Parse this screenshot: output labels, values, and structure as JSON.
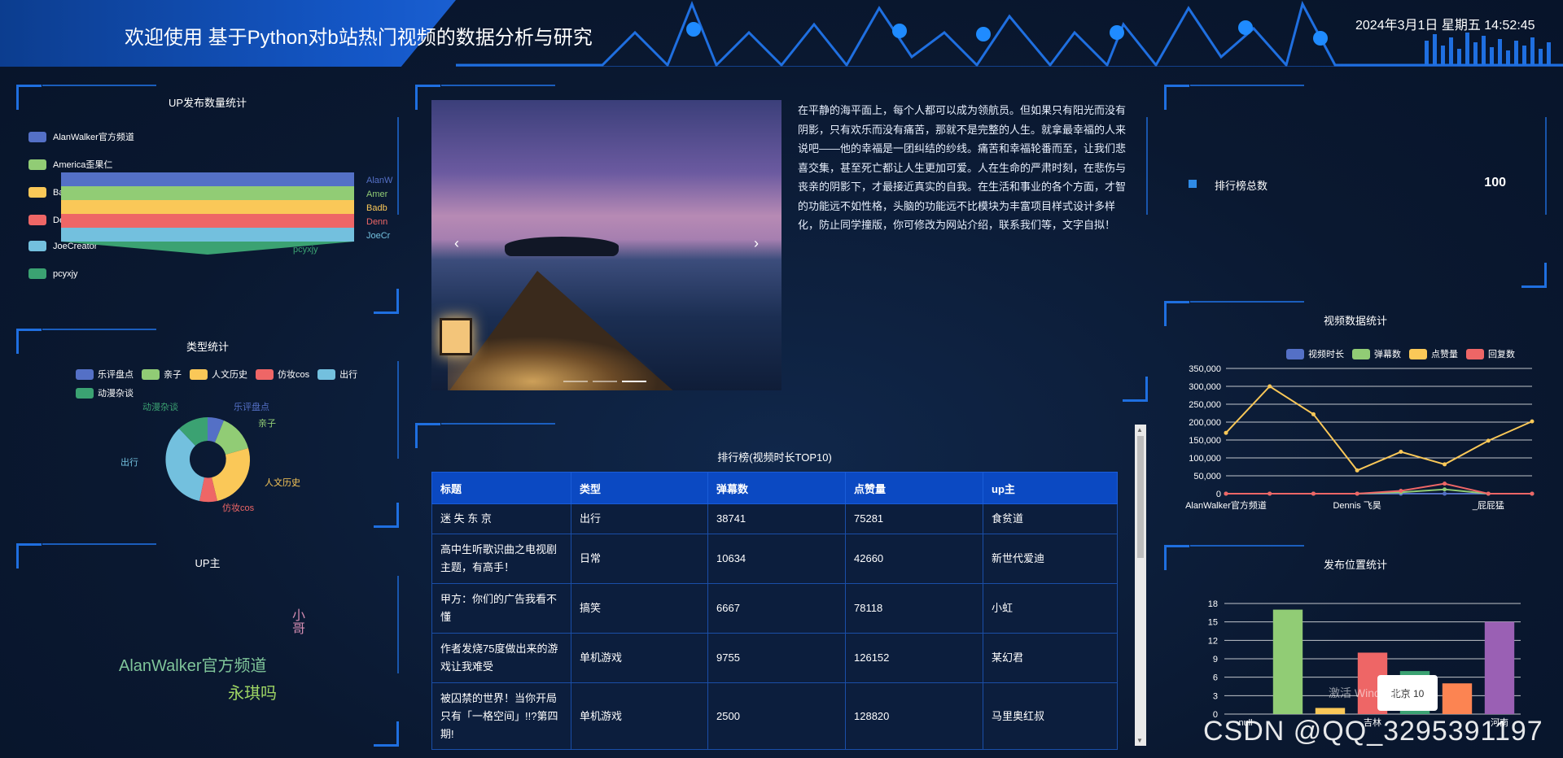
{
  "header": {
    "title": "欢迎使用 基于Python对b站热门视频的数据分析与研究",
    "datetime": "2024年3月1日 星期五 14:52:45"
  },
  "up_count": {
    "title": "UP发布数量统计",
    "legend": [
      "AlanWalker官方频道",
      "America歪果仁",
      "Badboy糖主",
      "Dennis 飞昊",
      "JoeCreator",
      "pcyxjy"
    ],
    "funnel_labels": [
      "AlanW",
      "Amer",
      "Badb",
      "Denn",
      "JoeCr"
    ],
    "funnel_bottom_label": "pcyxjy"
  },
  "type_stats": {
    "title": "类型统计",
    "legend": [
      "乐评盘点",
      "亲子",
      "人文历史",
      "仿妆cos",
      "出行",
      "动漫杂谈"
    ],
    "labels": [
      "动漫杂谈",
      "乐评盘点",
      "亲子",
      "人文历史",
      "仿妆cos",
      "出行"
    ]
  },
  "up_cloud": {
    "title": "UP主",
    "words": [
      {
        "text": "AlanWalker官方频道",
        "color": "#7fc59a",
        "size": 20
      },
      {
        "text": "永琪吗",
        "color": "#9fd664",
        "size": 20
      },
      {
        "text": "小哥",
        "color": "#d18bb0",
        "size": 16
      }
    ]
  },
  "intro": {
    "text": "在平静的海平面上，每个人都可以成为领航员。但如果只有阳光而没有阴影，只有欢乐而没有痛苦，那就不是完整的人生。就拿最幸福的人来说吧——他的幸福是一团纠结的纱线。痛苦和幸福轮番而至，让我们悲喜交集，甚至死亡都让人生更加可爱。人在生命的严肃时刻，在悲伤与丧亲的阴影下，才最接近真实的自我。在生活和事业的各个方面，才智的功能远不如性格，头脑的功能远不比模块为丰富项目样式设计多样化，防止同学撞版，你可修改为网站介绍，联系我们等，文字自拟！"
  },
  "carousel": {
    "prev": "‹",
    "next": "›"
  },
  "ranking": {
    "title": "排行榜(视频时长TOP10)",
    "columns": [
      "标题",
      "类型",
      "弹幕数",
      "点赞量",
      "up主"
    ],
    "rows": [
      [
        "迷 失 东 京",
        "出行",
        "38741",
        "75281",
        "食贫道"
      ],
      [
        "高中生听歌识曲之电视剧主题，有高手！",
        "日常",
        "10634",
        "42660",
        "新世代爱迪"
      ],
      [
        "甲方：你们的广告我看不懂",
        "搞笑",
        "6667",
        "78118",
        "小虹"
      ],
      [
        "作者发烧75度做出来的游戏让我难受",
        "单机游戏",
        "9755",
        "126152",
        "某幻君"
      ],
      [
        "被囚禁的世界！当你开局只有「一格空间」!!?第四期!",
        "单机游戏",
        "2500",
        "128820",
        "马里奥红叔"
      ]
    ]
  },
  "total": {
    "label": "排行榜总数",
    "value": "100"
  },
  "video_stats": {
    "title": "视频数据统计",
    "legend": [
      "视频时长",
      "弹幕数",
      "点赞量",
      "回复数"
    ],
    "chart_data": {
      "type": "line",
      "x_labels_shown": [
        "AlanWalker官方频道",
        "Dennis 飞昊",
        "_屁屁猛"
      ],
      "y_ticks": [
        "0",
        "50,000",
        "100,000",
        "150,000",
        "200,000",
        "250,000",
        "300,000",
        "350,000"
      ],
      "ylim": [
        0,
        350000
      ],
      "series": [
        {
          "name": "视频时长",
          "color": "#5470c6",
          "values": [
            0,
            0,
            0,
            0,
            0,
            0,
            0,
            0
          ]
        },
        {
          "name": "弹幕数",
          "color": "#91cc75",
          "values": [
            0,
            0,
            0,
            0,
            4000,
            12000,
            0,
            0
          ]
        },
        {
          "name": "点赞量",
          "color": "#fac858",
          "values": [
            170000,
            300000,
            222000,
            65000,
            117000,
            82000,
            148000,
            202000
          ]
        },
        {
          "name": "回复数",
          "color": "#ee6666",
          "values": [
            0,
            0,
            0,
            0,
            8000,
            28000,
            0,
            0
          ]
        }
      ]
    }
  },
  "location_stats": {
    "title": "发布位置统计",
    "chart_data": {
      "type": "bar",
      "y_ticks": [
        "0",
        "3",
        "6",
        "9",
        "12",
        "15",
        "18"
      ],
      "ylim": [
        0,
        18
      ],
      "x_labels": [
        "null",
        "",
        "",
        "吉林",
        "",
        "",
        "河南"
      ],
      "values": [
        0,
        17,
        1,
        10,
        7,
        5,
        15
      ],
      "colors": [
        "#5470c6",
        "#91cc75",
        "#fac858",
        "#ee6666",
        "#3ba272",
        "#fc8452",
        "#9a60b4"
      ]
    },
    "tooltip": "北京 10"
  },
  "overlay": {
    "watermark": "CSDN @QQ_3295391197",
    "windows": "激活 Windows"
  }
}
